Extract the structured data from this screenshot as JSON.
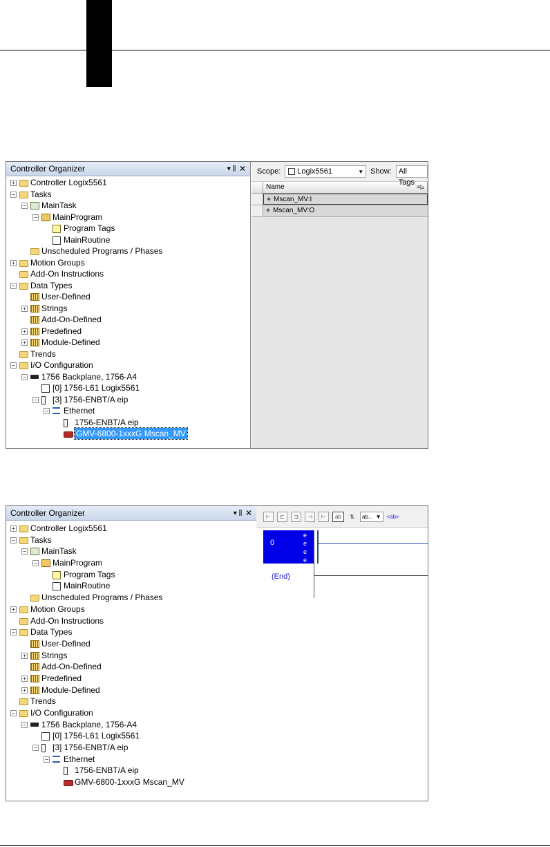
{
  "panels": [
    {
      "organizer": {
        "title": "Controller Organizer",
        "pin_glyph": "▾ ⫼",
        "close_glyph": "✕",
        "tree": [
          {
            "label": "Controller Logix5561",
            "indent": 0,
            "exp": "+",
            "icon": "folder"
          },
          {
            "label": "Tasks",
            "indent": 0,
            "exp": "−",
            "icon": "folder"
          },
          {
            "label": "MainTask",
            "indent": 1,
            "exp": "−",
            "icon": "task"
          },
          {
            "label": "MainProgram",
            "indent": 2,
            "exp": "−",
            "icon": "program"
          },
          {
            "label": "Program Tags",
            "indent": 3,
            "exp": "",
            "icon": "tags"
          },
          {
            "label": "MainRoutine",
            "indent": 3,
            "exp": "",
            "icon": "routine"
          },
          {
            "label": "Unscheduled Programs / Phases",
            "indent": 1,
            "exp": "",
            "icon": "folder"
          },
          {
            "label": "Motion Groups",
            "indent": 0,
            "exp": "+",
            "icon": "folder"
          },
          {
            "label": "Add-On Instructions",
            "indent": 0,
            "exp": "",
            "icon": "folder"
          },
          {
            "label": "Data Types",
            "indent": 0,
            "exp": "−",
            "icon": "folder"
          },
          {
            "label": "User-Defined",
            "indent": 1,
            "exp": "",
            "icon": "dtype"
          },
          {
            "label": "Strings",
            "indent": 1,
            "exp": "+",
            "icon": "dtype"
          },
          {
            "label": "Add-On-Defined",
            "indent": 1,
            "exp": "",
            "icon": "dtype"
          },
          {
            "label": "Predefined",
            "indent": 1,
            "exp": "+",
            "icon": "dtype"
          },
          {
            "label": "Module-Defined",
            "indent": 1,
            "exp": "+",
            "icon": "dtype"
          },
          {
            "label": "Trends",
            "indent": 0,
            "exp": "",
            "icon": "folder"
          },
          {
            "label": "I/O Configuration",
            "indent": 0,
            "exp": "−",
            "icon": "folder"
          },
          {
            "label": "1756 Backplane, 1756-A4",
            "indent": 1,
            "exp": "−",
            "icon": "rack"
          },
          {
            "label": "[0] 1756-L61 Logix5561",
            "indent": 2,
            "exp": "",
            "icon": "cpu"
          },
          {
            "label": "[3] 1756-ENBT/A eip",
            "indent": 2,
            "exp": "−",
            "icon": "module"
          },
          {
            "label": "Ethernet",
            "indent": 3,
            "exp": "−",
            "icon": "net"
          },
          {
            "label": "1756-ENBT/A eip",
            "indent": 4,
            "exp": "",
            "icon": "module"
          },
          {
            "label": "GMV-6800-1xxxG Mscan_MV",
            "indent": 4,
            "exp": "",
            "icon": "device",
            "selected": true
          }
        ]
      },
      "tags": {
        "scope_label": "Scope:",
        "scope_value": "Logix5561",
        "show_label": "Show:",
        "show_value": "All Tags",
        "column_name": "Name",
        "rows": [
          "Mscan_MV:I",
          "Mscan_MV:O"
        ]
      }
    },
    {
      "organizer": {
        "title": "Controller Organizer",
        "pin_glyph": "▾ ⫼",
        "close_glyph": "✕",
        "tree": [
          {
            "label": "Controller Logix5561",
            "indent": 0,
            "exp": "+",
            "icon": "folder"
          },
          {
            "label": "Tasks",
            "indent": 0,
            "exp": "−",
            "icon": "folder"
          },
          {
            "label": "MainTask",
            "indent": 1,
            "exp": "−",
            "icon": "task"
          },
          {
            "label": "MainProgram",
            "indent": 2,
            "exp": "−",
            "icon": "program"
          },
          {
            "label": "Program Tags",
            "indent": 3,
            "exp": "",
            "icon": "tags"
          },
          {
            "label": "MainRoutine",
            "indent": 3,
            "exp": "",
            "icon": "routine"
          },
          {
            "label": "Unscheduled Programs / Phases",
            "indent": 1,
            "exp": "",
            "icon": "folder"
          },
          {
            "label": "Motion Groups",
            "indent": 0,
            "exp": "+",
            "icon": "folder"
          },
          {
            "label": "Add-On Instructions",
            "indent": 0,
            "exp": "",
            "icon": "folder"
          },
          {
            "label": "Data Types",
            "indent": 0,
            "exp": "−",
            "icon": "folder"
          },
          {
            "label": "User-Defined",
            "indent": 1,
            "exp": "",
            "icon": "dtype"
          },
          {
            "label": "Strings",
            "indent": 1,
            "exp": "+",
            "icon": "dtype"
          },
          {
            "label": "Add-On-Defined",
            "indent": 1,
            "exp": "",
            "icon": "dtype"
          },
          {
            "label": "Predefined",
            "indent": 1,
            "exp": "+",
            "icon": "dtype"
          },
          {
            "label": "Module-Defined",
            "indent": 1,
            "exp": "+",
            "icon": "dtype"
          },
          {
            "label": "Trends",
            "indent": 0,
            "exp": "",
            "icon": "folder"
          },
          {
            "label": "I/O Configuration",
            "indent": 0,
            "exp": "−",
            "icon": "folder"
          },
          {
            "label": "1756 Backplane, 1756-A4",
            "indent": 1,
            "exp": "−",
            "icon": "rack"
          },
          {
            "label": "[0] 1756-L61 Logix5561",
            "indent": 2,
            "exp": "",
            "icon": "cpu"
          },
          {
            "label": "[3] 1756-ENBT/A eip",
            "indent": 2,
            "exp": "−",
            "icon": "module"
          },
          {
            "label": "Ethernet",
            "indent": 3,
            "exp": "−",
            "icon": "net"
          },
          {
            "label": "1756-ENBT/A eip",
            "indent": 4,
            "exp": "",
            "icon": "module"
          },
          {
            "label": "GMV-6800-1xxxG Mscan_MV",
            "indent": 4,
            "exp": "",
            "icon": "device"
          }
        ]
      },
      "ladder": {
        "toolbar_dropdown": "ab...",
        "toolbar_tag": "<ab>",
        "rung_number": "0",
        "rung_marks": [
          "e",
          "e",
          "e",
          "e"
        ],
        "end_label": "(End)"
      }
    }
  ]
}
